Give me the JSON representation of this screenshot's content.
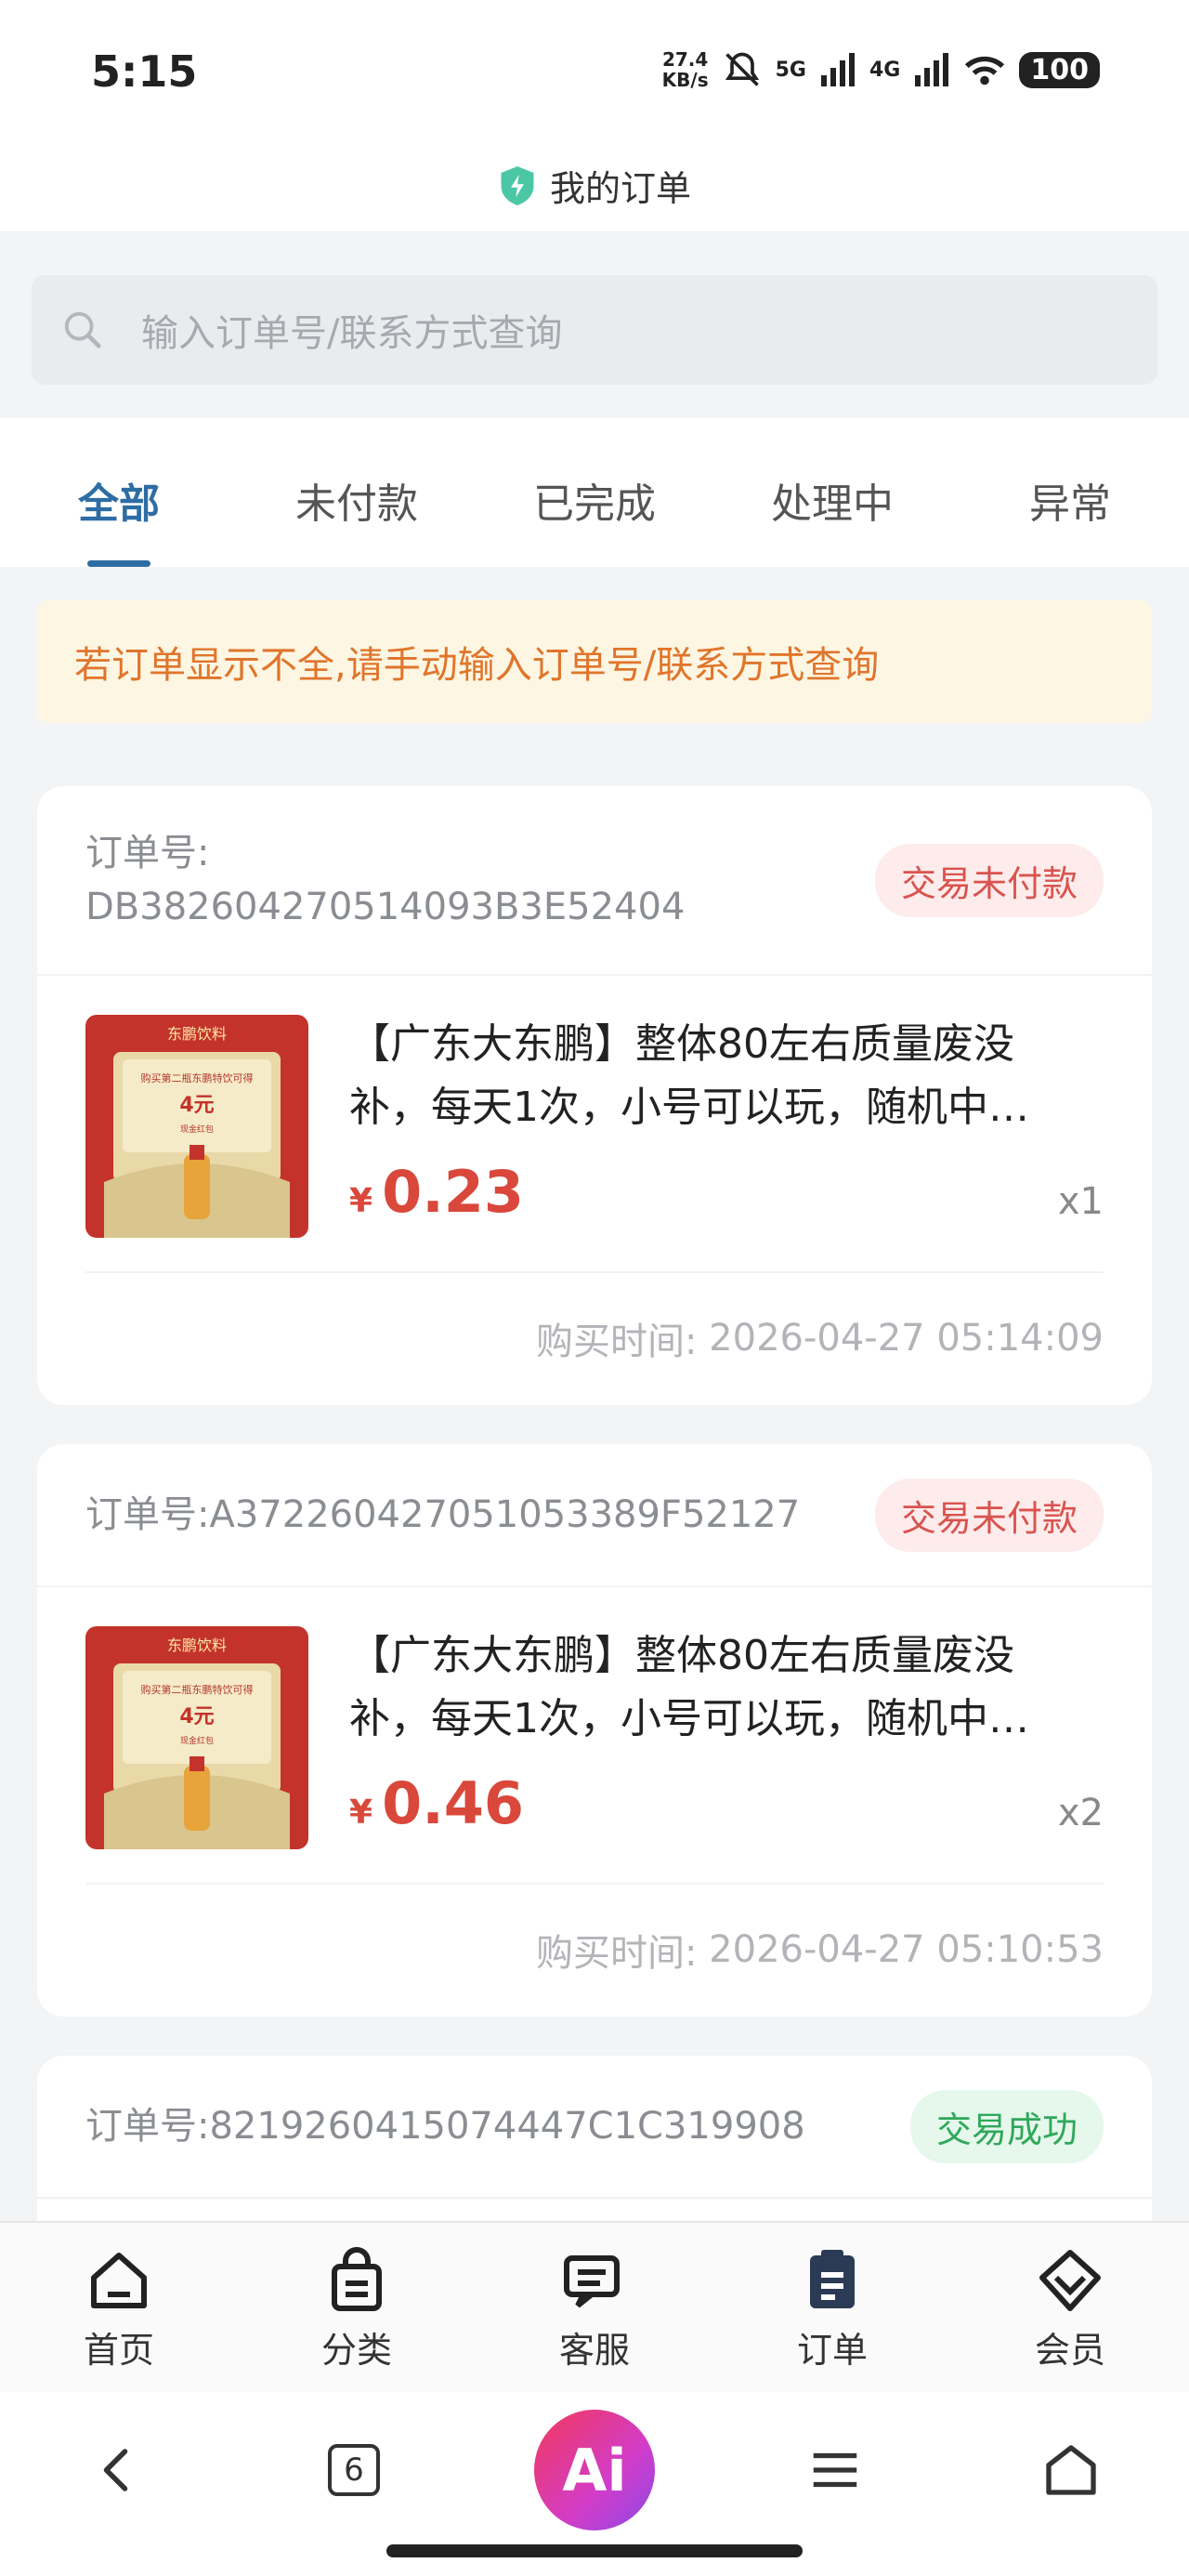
{
  "status_bar": {
    "time": "5:15",
    "speed_value": "27.4",
    "speed_unit": "KB/s",
    "net1": "5G",
    "net2": "4G",
    "battery": "100"
  },
  "title_bar": {
    "title": "我的订单",
    "icon": "shield-bolt-icon"
  },
  "search": {
    "placeholder": "输入订单号/联系方式查询",
    "icon": "search-icon"
  },
  "tabs": [
    {
      "label": "全部",
      "active": true
    },
    {
      "label": "未付款",
      "active": false
    },
    {
      "label": "已完成",
      "active": false
    },
    {
      "label": "处理中",
      "active": false
    },
    {
      "label": "异常",
      "active": false
    }
  ],
  "notice": "若订单显示不全,请手动输入订单号/联系方式查询",
  "orders": [
    {
      "order_label": "订单号:",
      "order_no": "DB382604270514093B3E52404",
      "status": "交易未付款",
      "product_title": "【广东大东鹏】整体80左右质量废没补，每天1次，小号可以玩，随机中…",
      "currency": "¥",
      "price": "0.23",
      "qty": "x1",
      "time_label": "购买时间:",
      "time": "2026-04-27 05:14:09"
    },
    {
      "order_label": "订单号:",
      "order_no": "A372260427051053389F52127",
      "status": "交易未付款",
      "product_title": "【广东大东鹏】整体80左右质量废没补，每天1次，小号可以玩，随机中…",
      "currency": "¥",
      "price": "0.46",
      "qty": "x2",
      "time_label": "购买时间:",
      "time": "2026-04-27 05:10:53"
    },
    {
      "order_label": "订单号:",
      "order_no": "8219260415074447C1C319908",
      "status": "交易成功"
    }
  ],
  "thumb": {
    "brand": "东鹏饮料",
    "line": "购买第二瓶东鹏特饮可得",
    "amount": "4元",
    "sub": "现金红包"
  },
  "bottom_nav": [
    {
      "label": "首页",
      "icon": "home-icon"
    },
    {
      "label": "分类",
      "icon": "bag-icon"
    },
    {
      "label": "客服",
      "icon": "chat-icon"
    },
    {
      "label": "订单",
      "icon": "clipboard-icon"
    },
    {
      "label": "会员",
      "icon": "diamond-icon"
    }
  ],
  "browser_bar": {
    "tab_count": "6",
    "ai_label": "Ai"
  },
  "colors": {
    "accent": "#2e6da4",
    "price": "#d9483b",
    "unpaid": "#d9534f",
    "success": "#2fa85a",
    "notice": "#e0752b"
  }
}
